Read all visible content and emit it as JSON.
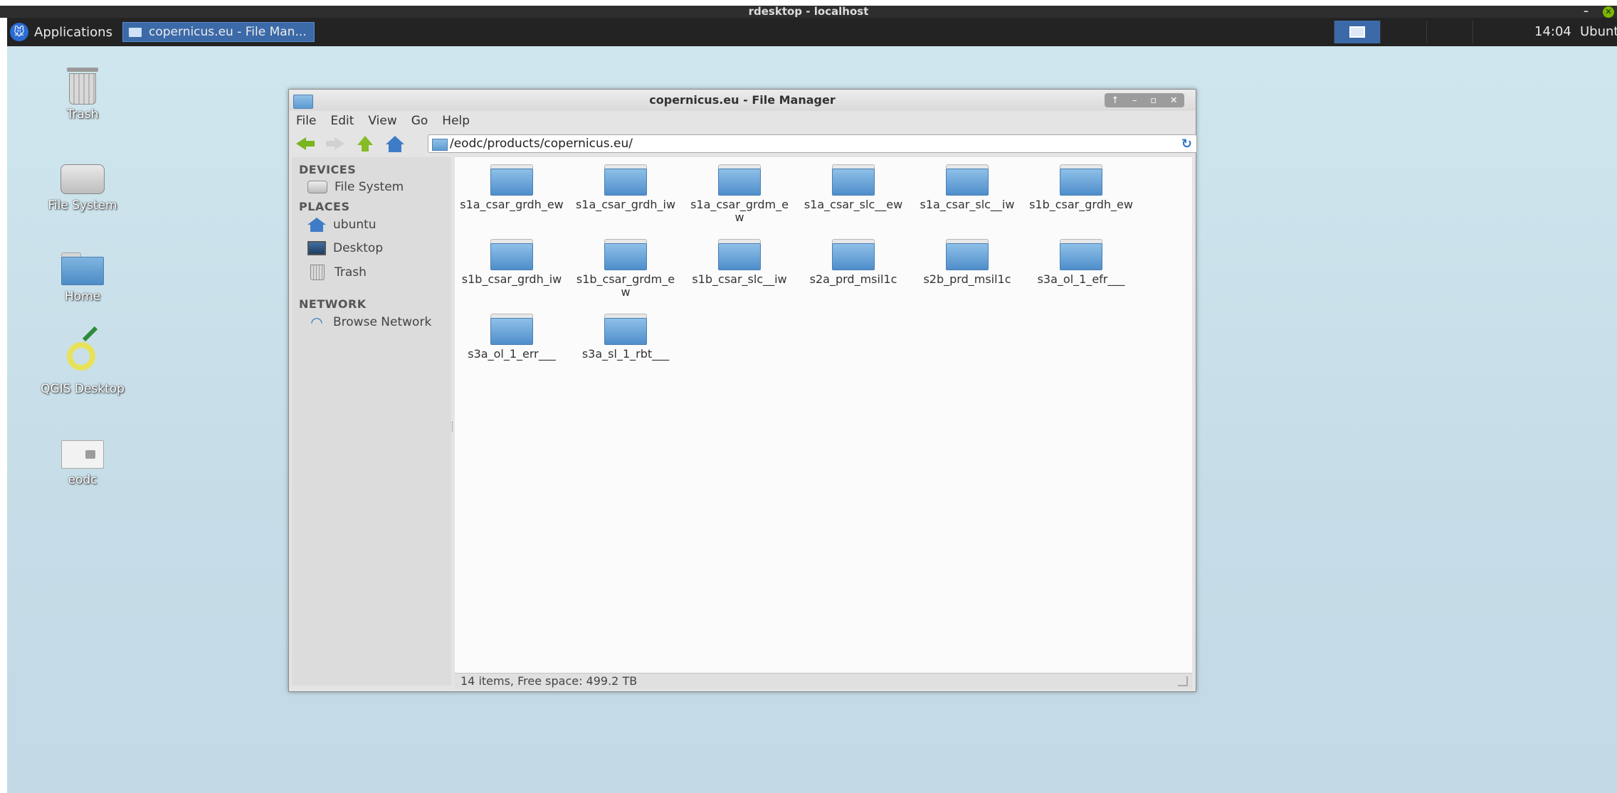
{
  "remote_window": {
    "title": "rdesktop - localhost",
    "minimize": "–",
    "close": "✕"
  },
  "panel": {
    "applications_label": "Applications",
    "task_button_label": "copernicus.eu - File Man...",
    "clock": "14:04",
    "user": "Ubunt"
  },
  "desktop_icons": [
    {
      "label": "Trash",
      "icon": "trash-icon"
    },
    {
      "label": "File System",
      "icon": "hard-drive-icon"
    },
    {
      "label": "Home",
      "icon": "home-folder-icon"
    },
    {
      "label": "QGIS Desktop",
      "icon": "qgis-icon"
    },
    {
      "label": "eodc",
      "icon": "network-folder-icon"
    }
  ],
  "file_manager": {
    "title": "copernicus.eu - File Manager",
    "menu": [
      "File",
      "Edit",
      "View",
      "Go",
      "Help"
    ],
    "path": "/eodc/products/copernicus.eu/",
    "sidebar": {
      "devices_header": "DEVICES",
      "devices": [
        {
          "label": "File System",
          "icon": "hard-drive-icon"
        }
      ],
      "places_header": "PLACES",
      "places": [
        {
          "label": "ubuntu",
          "icon": "home-icon"
        },
        {
          "label": "Desktop",
          "icon": "desktop-icon"
        },
        {
          "label": "Trash",
          "icon": "trash-icon"
        }
      ],
      "network_header": "NETWORK",
      "network": [
        {
          "label": "Browse Network",
          "icon": "wifi-icon"
        }
      ]
    },
    "items": [
      "s1a_csar_grdh_ew",
      "s1a_csar_grdh_iw",
      "s1a_csar_grdm_ew",
      "s1a_csar_slc__ew",
      "s1a_csar_slc__iw",
      "s1b_csar_grdh_ew",
      "s1b_csar_grdh_iw",
      "s1b_csar_grdm_ew",
      "s1b_csar_slc__iw",
      "s2a_prd_msil1c",
      "s2b_prd_msil1c",
      "s3a_ol_1_efr___",
      "s3a_ol_1_err___",
      "s3a_sl_1_rbt___"
    ],
    "status": "14 items, Free space: 499.2 TB"
  },
  "colors": {
    "accent": "#3c6aa8",
    "folder": "#5e9bd1",
    "panel": "#232323"
  }
}
